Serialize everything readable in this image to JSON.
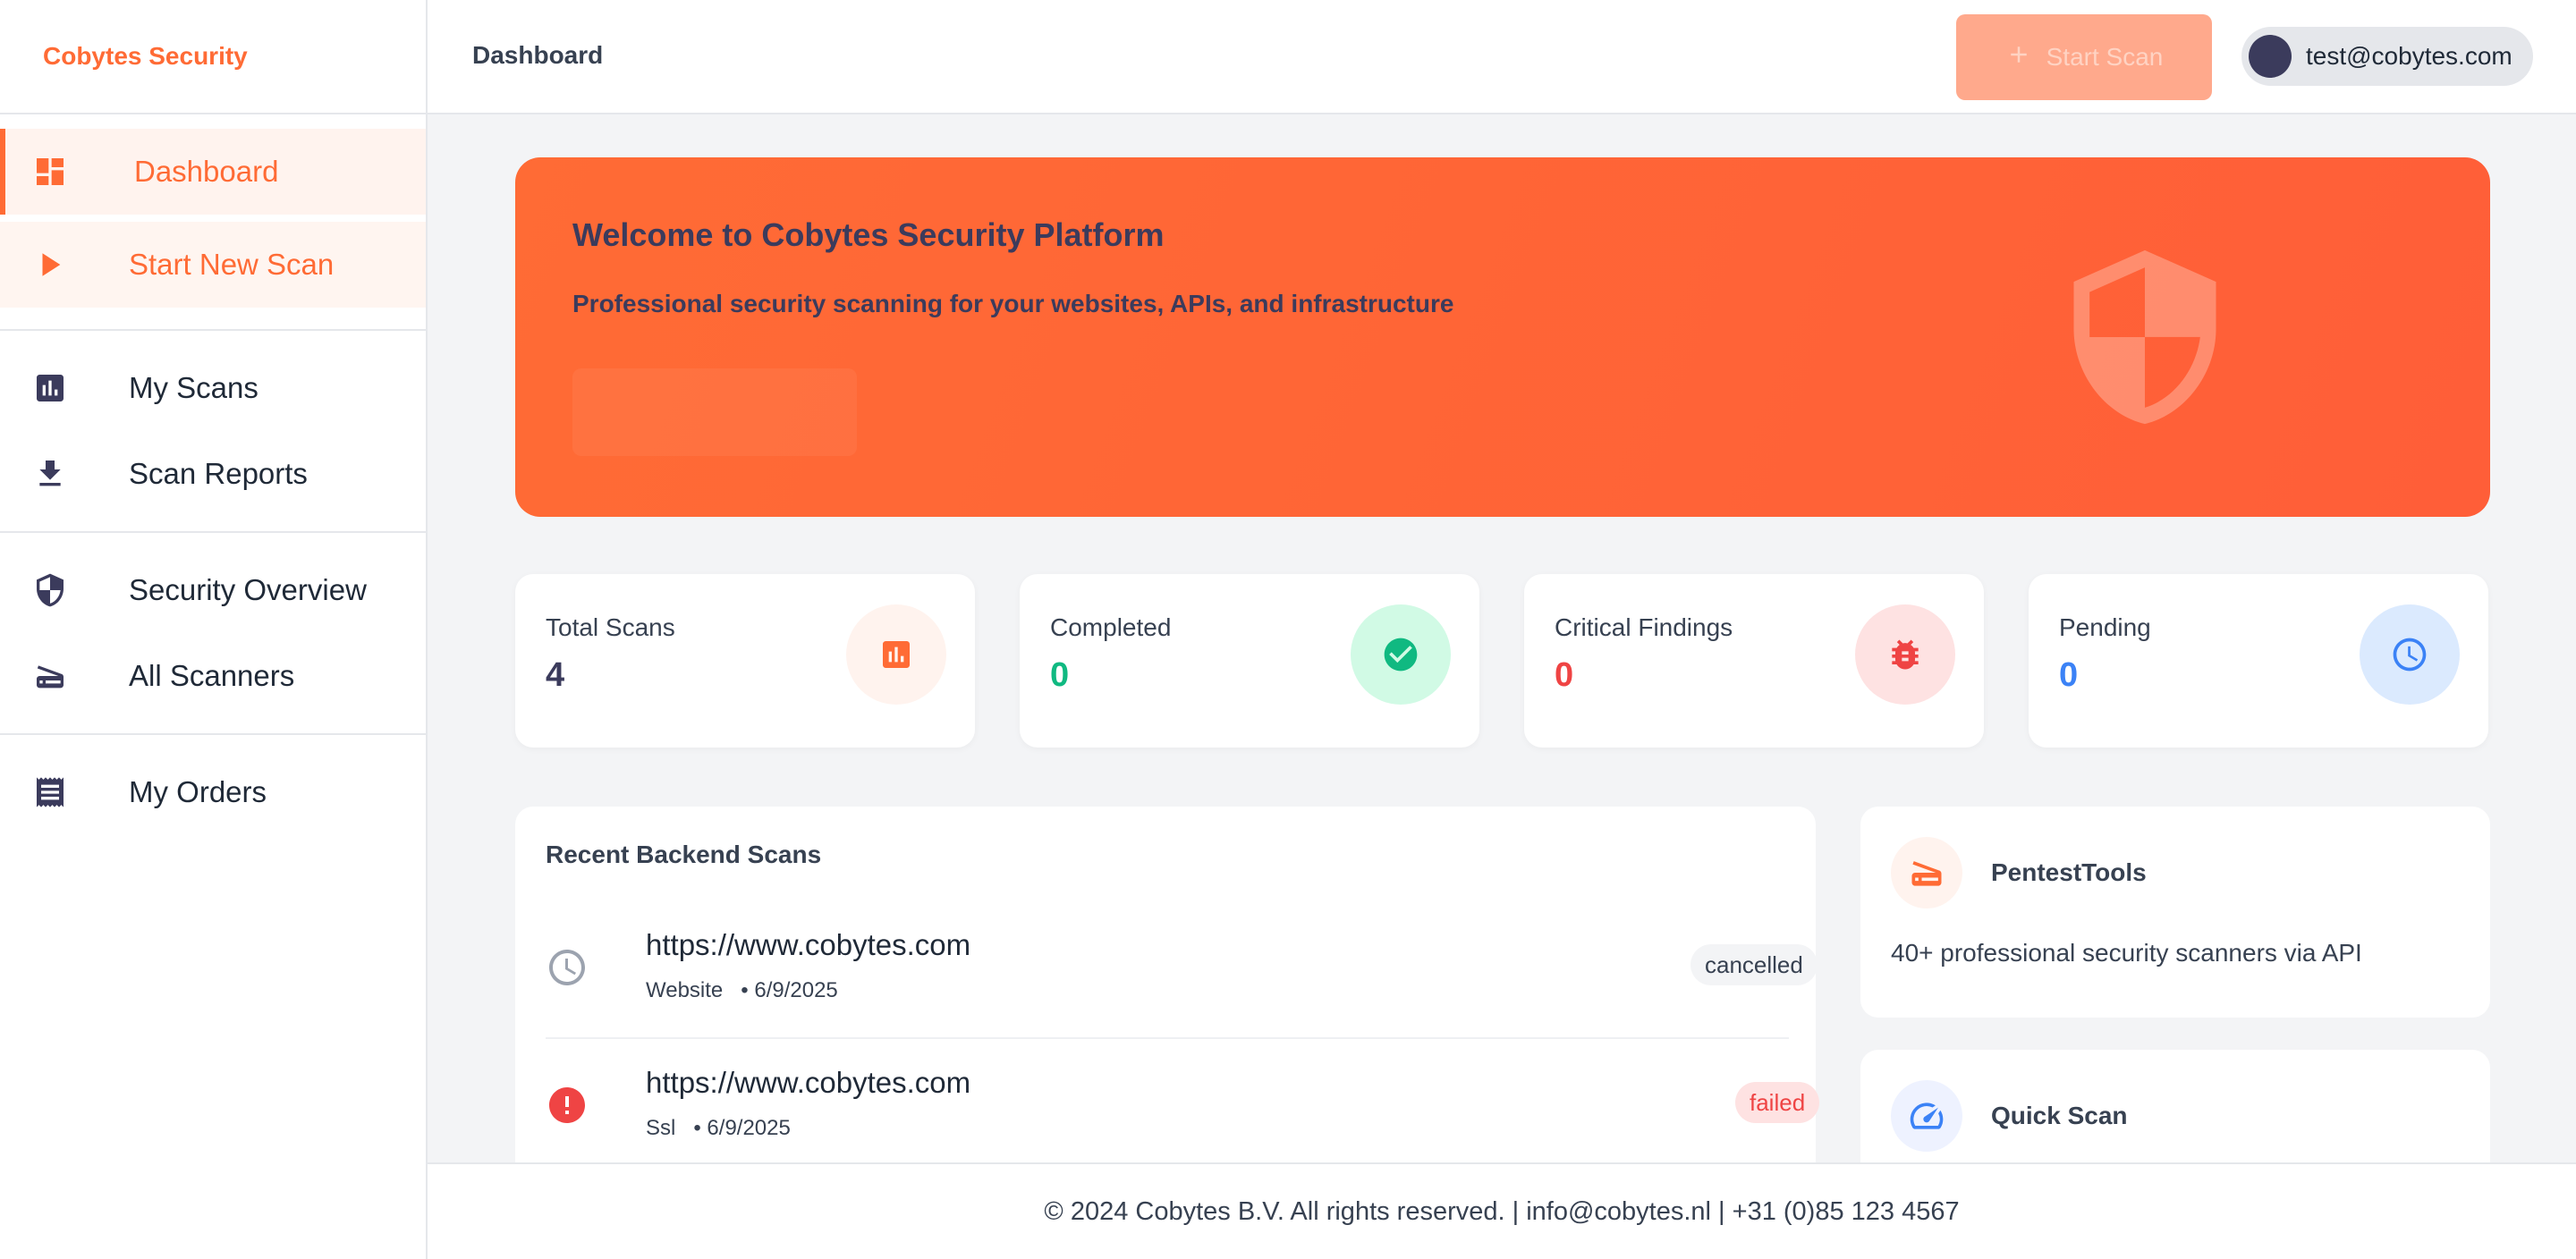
{
  "brand": {
    "name": "Cobytes Security"
  },
  "sidebar": {
    "groups": [
      [
        {
          "label": "Dashboard",
          "icon": "dashboard-icon",
          "state": "active"
        },
        {
          "label": "Start New Scan",
          "icon": "play-icon",
          "state": "highlighted"
        }
      ],
      [
        {
          "label": "My Scans",
          "icon": "bar-chart-icon"
        },
        {
          "label": "Scan Reports",
          "icon": "download-icon"
        }
      ],
      [
        {
          "label": "Security Overview",
          "icon": "shield-icon"
        },
        {
          "label": "All Scanners",
          "icon": "scanner-icon"
        }
      ],
      [
        {
          "label": "My Orders",
          "icon": "receipt-icon"
        }
      ]
    ]
  },
  "header": {
    "title": "Dashboard",
    "start_scan_label": "Start Scan",
    "user_email": "test@cobytes.com"
  },
  "hero": {
    "title": "Welcome to Cobytes Security Platform",
    "subtitle": "Professional security scanning for your websites, APIs, and infrastructure"
  },
  "stats": [
    {
      "label": "Total Scans",
      "value": "4",
      "color": "#3b3b5c",
      "icon": "bar-chart-icon",
      "icon_color": "#ff6b35",
      "bg": "#fff3ee"
    },
    {
      "label": "Completed",
      "value": "0",
      "color": "#10b981",
      "icon": "check-circle-icon",
      "icon_color": "#10b981",
      "bg": "#d1fae5"
    },
    {
      "label": "Critical Findings",
      "value": "0",
      "color": "#ef4444",
      "icon": "bug-icon",
      "icon_color": "#ef4444",
      "bg": "#fee2e2"
    },
    {
      "label": "Pending",
      "value": "0",
      "color": "#3b82f6",
      "icon": "clock-icon",
      "icon_color": "#3b82f6",
      "bg": "#dbeafe"
    }
  ],
  "recent_scans": {
    "title": "Recent Backend Scans",
    "rows": [
      {
        "url": "https://www.cobytes.com",
        "type": "Website",
        "date": "6/9/2025",
        "status": "cancelled",
        "icon": "clock-icon"
      },
      {
        "url": "https://www.cobytes.com",
        "type": "Ssl",
        "date": "6/9/2025",
        "status": "failed",
        "icon": "error-icon"
      }
    ]
  },
  "right_cards": [
    {
      "title": "PentestTools",
      "desc": "40+ professional security scanners via API",
      "icon": "scanner-icon"
    },
    {
      "title": "Quick Scan",
      "desc": "",
      "icon": "speedometer-icon"
    }
  ],
  "footer": {
    "text": "© 2024 Cobytes B.V. All rights reserved. | info@cobytes.nl | +31 (0)85 123 4567"
  },
  "colors": {
    "accent": "#ff6b35",
    "dark": "#3b3b5c"
  }
}
